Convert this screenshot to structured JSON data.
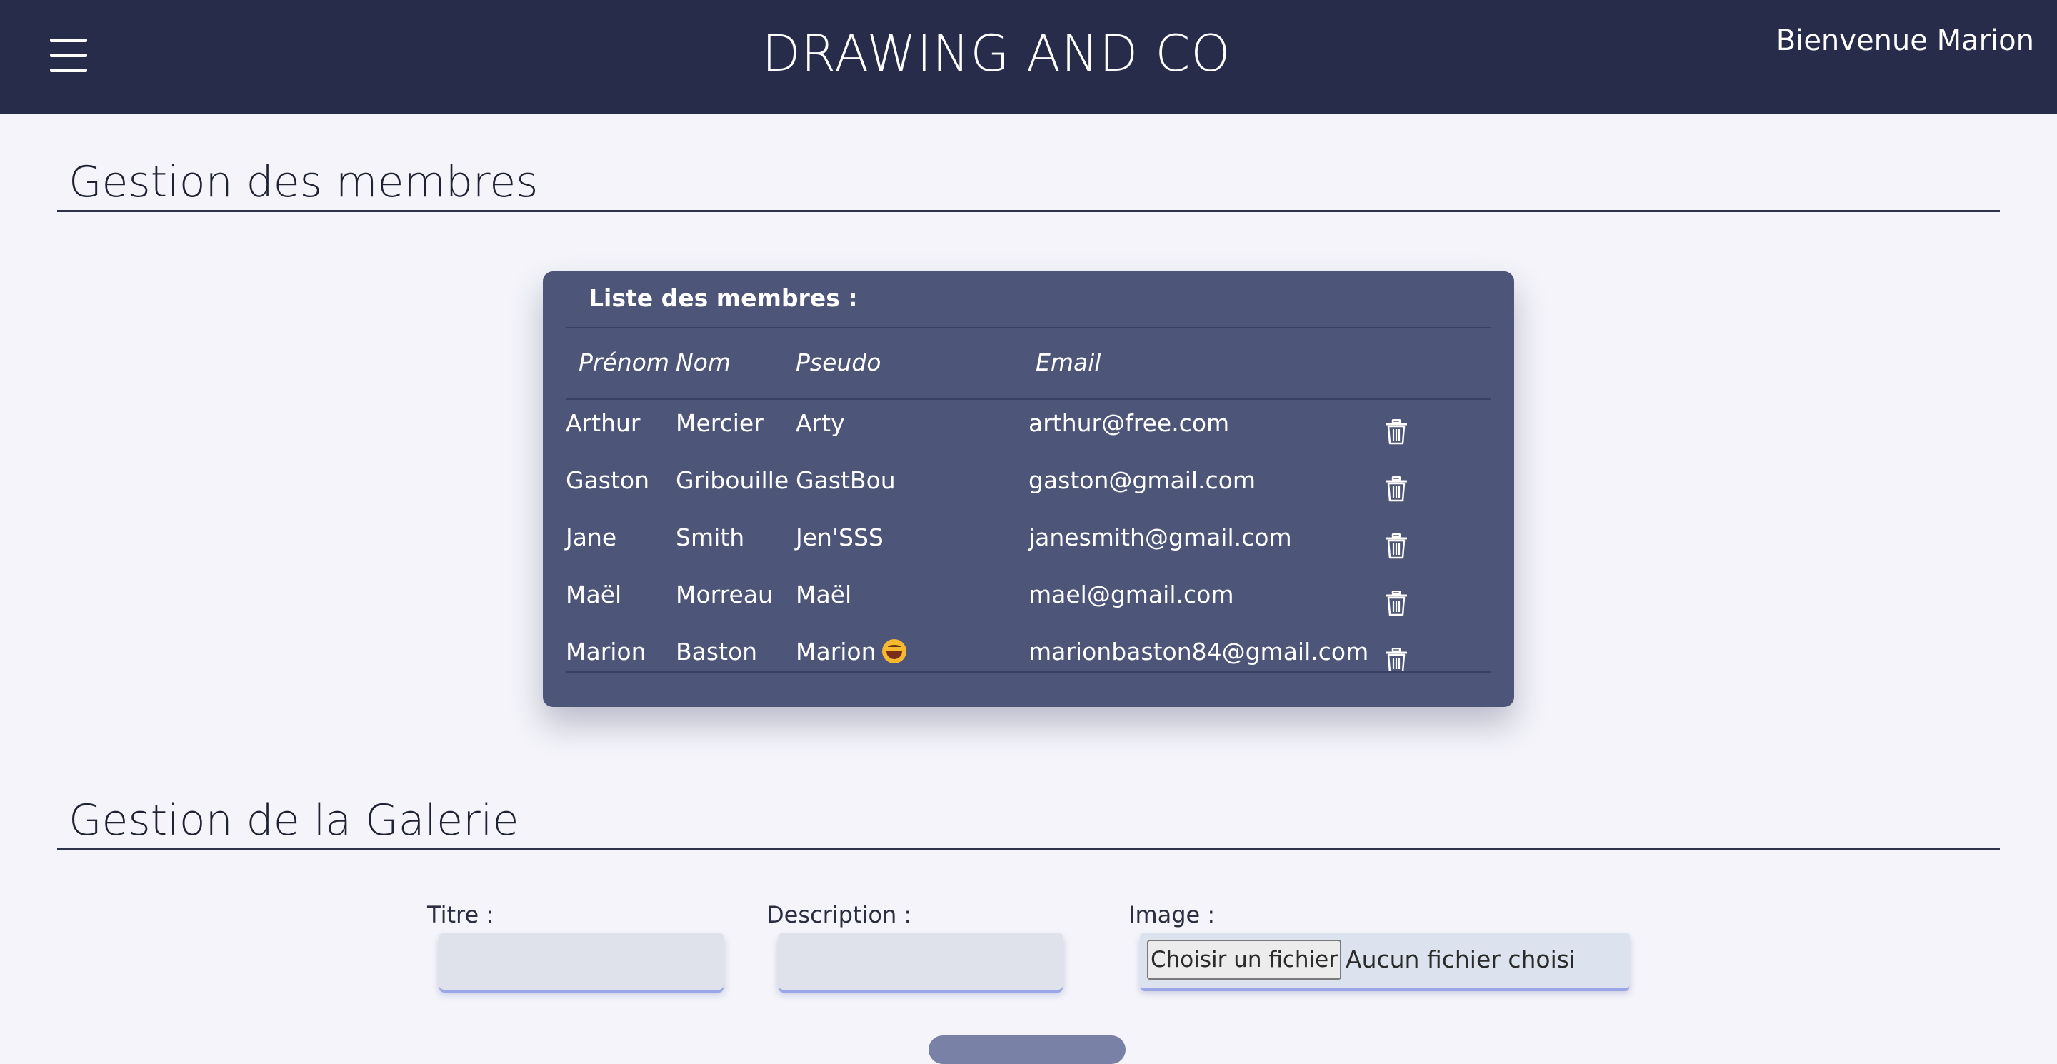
{
  "header": {
    "menu_icon": "hamburger-menu-icon",
    "title": "DRAWING AND CO",
    "welcome": "Bienvenue Marion"
  },
  "members_section": {
    "title": "Gestion des membres",
    "card_title": "Liste des membres :",
    "columns": [
      "Prénom",
      "Nom",
      "Pseudo",
      "Email"
    ],
    "rows": [
      {
        "prenom": "Arthur",
        "nom": "Mercier",
        "pseudo": "Arty",
        "email": "arthur@free.com"
      },
      {
        "prenom": "Gaston",
        "nom": "Gribouille",
        "pseudo": "GastBou",
        "email": "gaston@gmail.com"
      },
      {
        "prenom": "Jane",
        "nom": "Smith",
        "pseudo": "Jen'SSS",
        "email": "janesmith@gmail.com"
      },
      {
        "prenom": "Maël",
        "nom": "Morreau",
        "pseudo": "Maël",
        "email": "mael@gmail.com"
      },
      {
        "prenom": "Marion",
        "nom": "Baston",
        "pseudo": "Marion",
        "email": "marionbaston84@gmail.com"
      }
    ],
    "row_action_icon": "trash-icon"
  },
  "gallery_section": {
    "title": "Gestion de la Galerie",
    "titre_label": "Titre :",
    "titre_value": "",
    "description_label": "Description :",
    "description_value": "",
    "image_label": "Image :",
    "file_button": "Choisir un fichier",
    "file_status": "Aucun fichier choisi"
  },
  "colors": {
    "header_bg": "#262c4a",
    "page_bg": "#f4f4fa",
    "card_bg": "#4d5578"
  }
}
